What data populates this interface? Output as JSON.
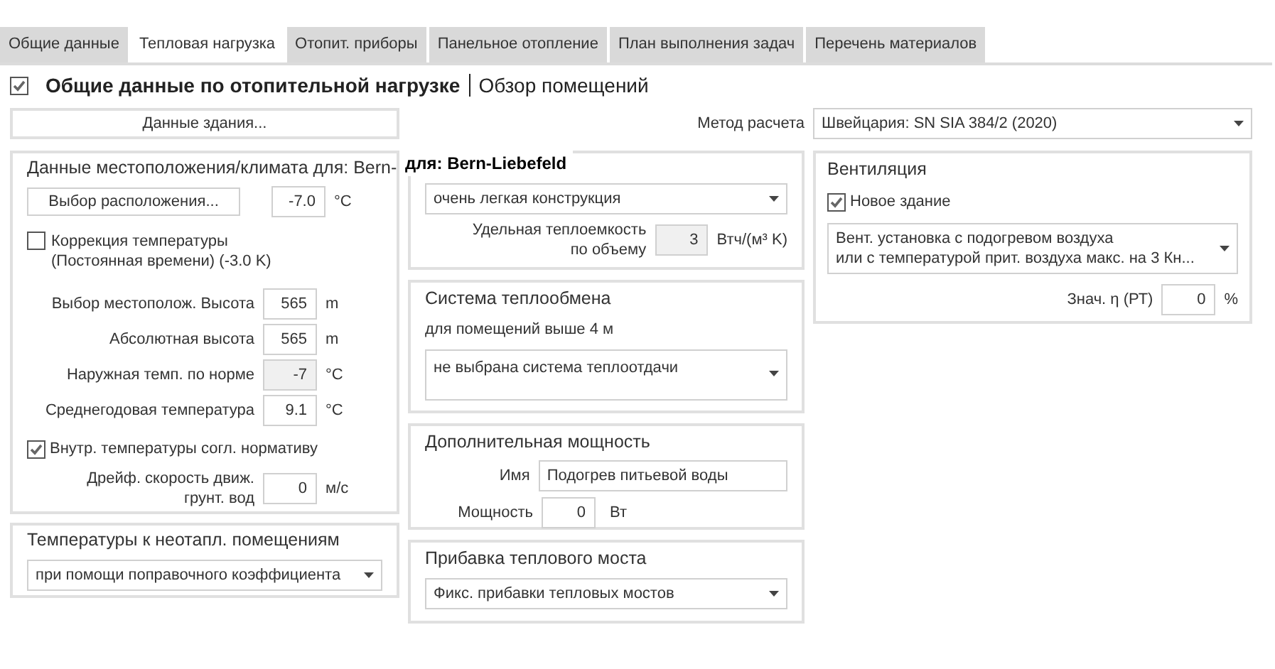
{
  "tabs": [
    {
      "label": "Общие данные",
      "selected": false
    },
    {
      "label": "Тепловая нагрузка",
      "selected": true
    },
    {
      "label": "Отопит. приборы",
      "selected": false
    },
    {
      "label": "Панельное отопление",
      "selected": false
    },
    {
      "label": "План выполнения задач",
      "selected": false
    },
    {
      "label": "Перечень материалов",
      "selected": false
    }
  ],
  "header": {
    "checked": true,
    "title": "Общие данные по отопительной нагрузке",
    "link": "Обзор помещений"
  },
  "building_button": "Данные здания...",
  "calc_method": {
    "label": "Метод расчета",
    "value": "Швейцария: SN SIA 384/2 (2020)"
  },
  "climate": {
    "title": "Данные местоположения/климата для: Bern-",
    "overlay_label": "для: Bern-Liebefeld",
    "location_button": "Выбор расположения...",
    "design_temp": {
      "value": "-7.0",
      "unit": "°C"
    },
    "correction": {
      "checked": false,
      "label": "Коррекция температуры\n(Постоянная времени) (-3.0 K)"
    },
    "fields": [
      {
        "label": "Выбор местополож. Высота",
        "value": "565",
        "unit": "m",
        "disabled": false
      },
      {
        "label": "Абсолютная высота",
        "value": "565",
        "unit": "m",
        "disabled": false
      },
      {
        "label": "Наружная темп. по норме",
        "value": "-7",
        "unit": "°C",
        "disabled": true
      },
      {
        "label": "Среднегодовая температура",
        "value": "9.1",
        "unit": "°C",
        "disabled": false
      }
    ],
    "inner_temps": {
      "checked": true,
      "label": "Внутр. температуры согл. нормативу"
    },
    "groundwater": {
      "label": "Дрейф. скорость движ.\nгрунт. вод",
      "value": "0",
      "unit": "м/с",
      "disabled": false
    }
  },
  "unheated": {
    "title": "Температуры к неотапл. помещениям",
    "value": "при помощи поправочного коэффициента"
  },
  "construction": {
    "value": "очень легкая конструкция",
    "capacity": {
      "label": "Удельная теплоемкость\nпо объему",
      "value": "3",
      "unit": "Втч/(м³ K)",
      "disabled": true
    }
  },
  "heat_exchange": {
    "title": "Система теплообмена",
    "subtitle": "для помещений выше 4 м",
    "value": "не выбрана система теплоотдачи"
  },
  "additional_power": {
    "title": "Дополнительная мощность",
    "name_label": "Имя",
    "name_value": "Подогрев питьевой воды",
    "power": {
      "label": "Мощность",
      "value": "0",
      "unit": "Вт",
      "disabled": false
    }
  },
  "thermal_bridge": {
    "title": "Прибавка теплового моста",
    "value": "Фикс. прибавки тепловых мостов"
  },
  "ventilation": {
    "title": "Вентиляция",
    "new_building": {
      "checked": true,
      "label": "Новое здание"
    },
    "system": "Вент. установка с подогревом воздуха\nили с температурой прит. воздуха макс. на 3 Кн...",
    "efficiency": {
      "label": "Знач. η (РТ)",
      "value": "0",
      "unit": "%"
    }
  }
}
